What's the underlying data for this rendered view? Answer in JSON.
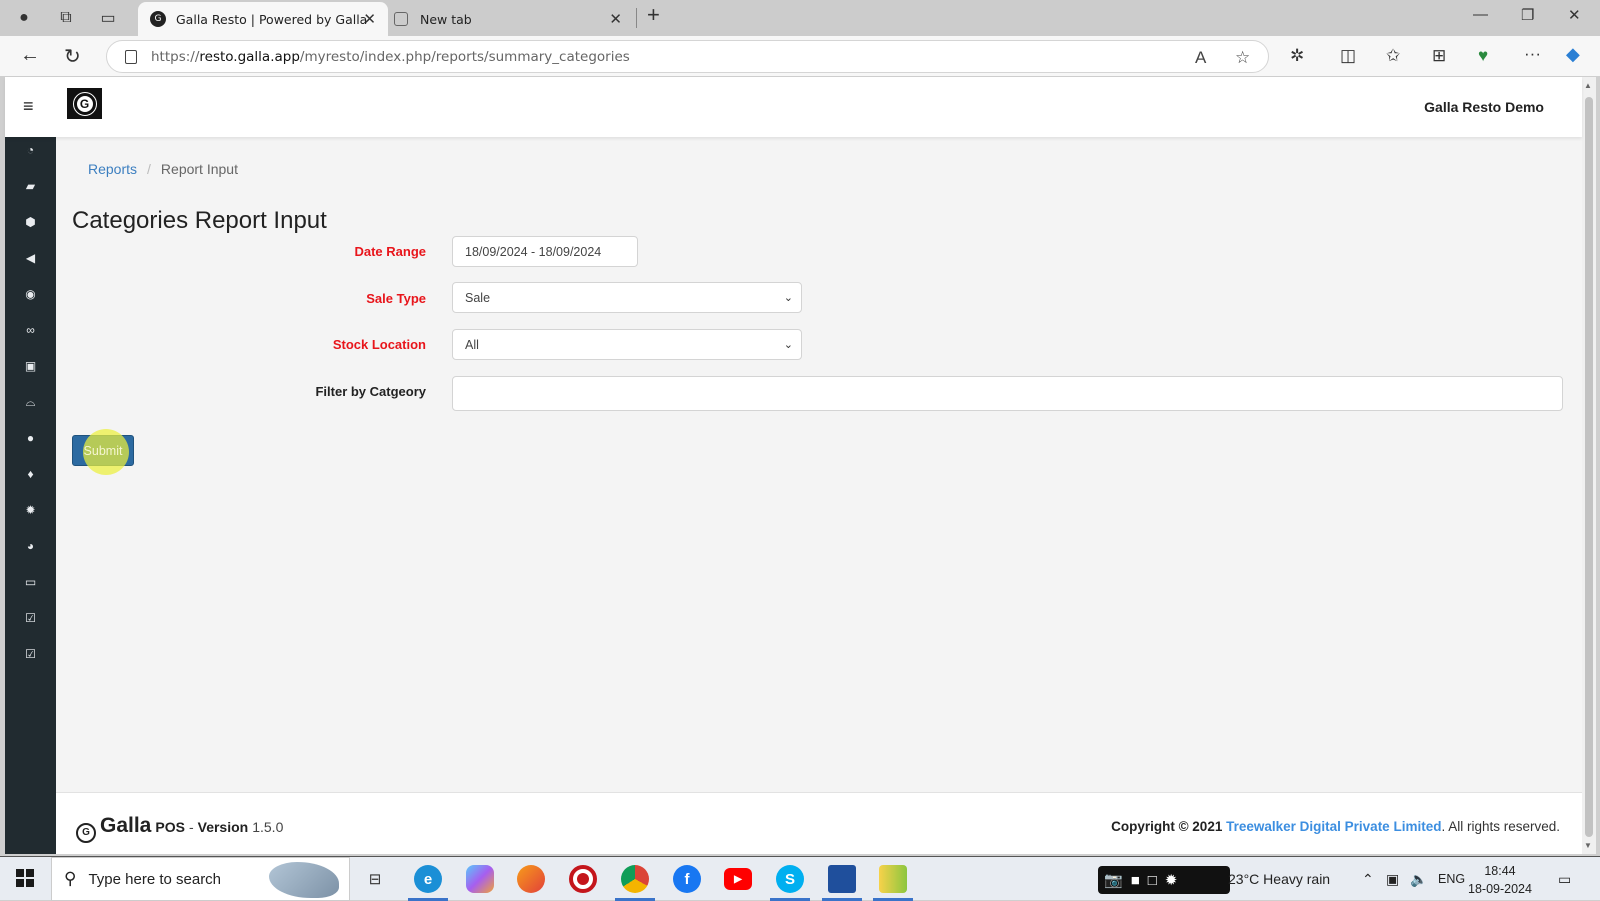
{
  "browser": {
    "tabs": [
      {
        "title": "Galla Resto | Powered by Galla",
        "active": true,
        "favicon": "galla-logo-icon"
      },
      {
        "title": "New tab",
        "active": false,
        "favicon": "new-tab-icon"
      }
    ],
    "url": {
      "prefix": "https://",
      "domain": "resto.galla.app",
      "path": "/myresto/index.php/reports/summary_categories"
    },
    "icons": [
      "back-icon",
      "refresh-icon",
      "lock-icon",
      "read-aloud-icon",
      "favorite-star-icon",
      "extensions-icon",
      "split-screen-icon",
      "favorites-icon",
      "collections-icon",
      "browser-essentials-icon",
      "more-icon",
      "copilot-icon"
    ]
  },
  "app": {
    "company": "Galla Resto Demo",
    "sidebar": {
      "items": [
        {
          "icon": "dashboard-icon",
          "glyph": "◔"
        },
        {
          "icon": "folder-open-icon",
          "glyph": "▰"
        },
        {
          "icon": "cube-icon",
          "glyph": "⬢"
        },
        {
          "icon": "bullhorn-icon",
          "glyph": "◀"
        },
        {
          "icon": "user-circle-icon",
          "glyph": "◉"
        },
        {
          "icon": "handshake-icon",
          "glyph": "∞"
        },
        {
          "icon": "gift-icon",
          "glyph": "▣"
        },
        {
          "icon": "shopping-basket-icon",
          "glyph": "⌓"
        },
        {
          "icon": "users-icon",
          "glyph": "●"
        },
        {
          "icon": "map-marker-icon",
          "glyph": "♦"
        },
        {
          "icon": "gear-icon",
          "glyph": "✹"
        },
        {
          "icon": "pie-chart-icon",
          "glyph": "◕"
        },
        {
          "icon": "money-icon",
          "glyph": "▭"
        },
        {
          "icon": "check-square-icon",
          "glyph": "☑"
        },
        {
          "icon": "check-square-icon",
          "glyph": "☑"
        }
      ]
    },
    "breadcrumb": {
      "parent": "Reports",
      "separator": "/",
      "current": "Report Input"
    },
    "page_title": "Categories Report Input",
    "form": {
      "date_range": {
        "label": "Date Range",
        "value": "18/09/2024 - 18/09/2024"
      },
      "sale_type": {
        "label": "Sale Type",
        "value": "Sale"
      },
      "stock_location": {
        "label": "Stock Location",
        "value": "All"
      },
      "filter_category": {
        "label": "Filter by Catgeory",
        "value": ""
      },
      "submit_label": "Submit"
    },
    "footer": {
      "brand": "Galla",
      "pos": "POS",
      "dash": "-",
      "version_label": "Version",
      "version": "1.5.0",
      "copyright": "Copyright © 2021",
      "company_link": "Treewalker Digital Private Limited",
      "rights": ". All rights reserved."
    }
  },
  "taskbar": {
    "search_placeholder": "Type here to search",
    "weather": "23°C  Heavy rain",
    "language": "ENG",
    "time": "18:44",
    "date": "18-09-2024",
    "apps": [
      "task-view-icon",
      "edge-icon",
      "copilot-icon",
      "firefox-icon",
      "recorder-icon",
      "chrome-icon",
      "facebook-icon",
      "youtube-icon",
      "skype-icon",
      "store-icon",
      "files-icon"
    ]
  }
}
